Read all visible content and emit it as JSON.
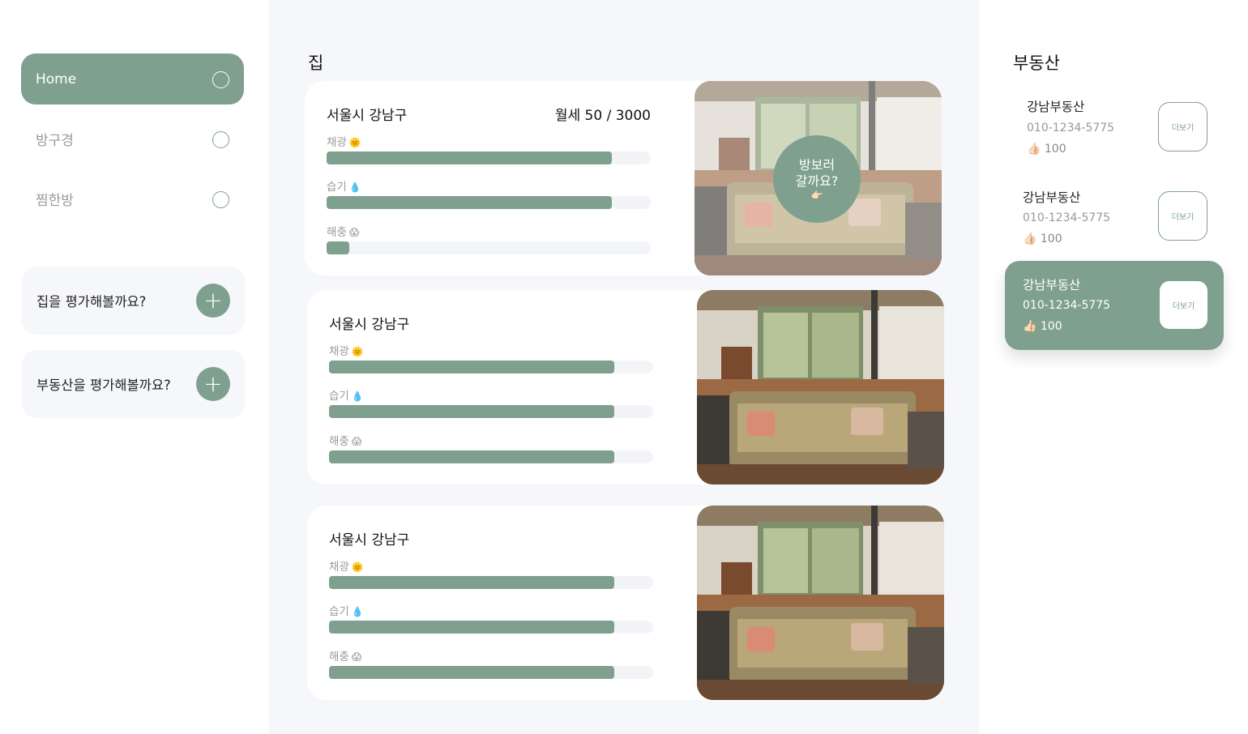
{
  "sidebar": {
    "nav": [
      {
        "label": "Home",
        "active": true
      },
      {
        "label": "방구경",
        "active": false
      },
      {
        "label": "찜한방",
        "active": false
      }
    ],
    "actions": [
      {
        "label": "집을 평가해볼까요?",
        "icon": "plus-icon"
      },
      {
        "label": "부동산을 평가해볼까요?",
        "icon": "plus-icon"
      }
    ]
  },
  "main": {
    "title": "집",
    "houses": [
      {
        "address": "서울시 강남구",
        "price": "월세 50 / 3000",
        "metrics": [
          {
            "label": "채광",
            "emoji": "🌞",
            "value": 0.88
          },
          {
            "label": "습기",
            "emoji": "💧",
            "value": 0.88
          },
          {
            "label": "해충",
            "emoji": "😱",
            "value": 0.07
          }
        ],
        "overlay": {
          "line1": "방보러",
          "line2": "갈까요?",
          "emoji": "👉🏻"
        }
      },
      {
        "address": "서울시 강남구",
        "metrics": [
          {
            "label": "채광",
            "emoji": "🌞",
            "value": 0.88
          },
          {
            "label": "습기",
            "emoji": "💧",
            "value": 0.88
          },
          {
            "label": "해충",
            "emoji": "😱",
            "value": 0.88
          }
        ]
      },
      {
        "address": "서울시 강남구",
        "metrics": [
          {
            "label": "채광",
            "emoji": "🌞",
            "value": 0.88
          },
          {
            "label": "습기",
            "emoji": "💧",
            "value": 0.88
          },
          {
            "label": "해충",
            "emoji": "😱",
            "value": 0.88
          }
        ]
      }
    ]
  },
  "right": {
    "title": "부동산",
    "agents": [
      {
        "name": "강남부동산",
        "phone": "010-1234-5775",
        "likes_emoji": "👍🏻",
        "likes": "100",
        "more": "더보기",
        "active": false
      },
      {
        "name": "강남부동산",
        "phone": "010-1234-5775",
        "likes_emoji": "👍🏻",
        "likes": "100",
        "more": "더보기",
        "active": false
      },
      {
        "name": "강남부동산",
        "phone": "010-1234-5775",
        "likes_emoji": "👍🏻",
        "likes": "100",
        "more": "더보기",
        "active": true
      }
    ]
  },
  "colors": {
    "accent": "#7fa08e",
    "main_bg": "#f6f7fb",
    "track": "#f3f4f8"
  }
}
